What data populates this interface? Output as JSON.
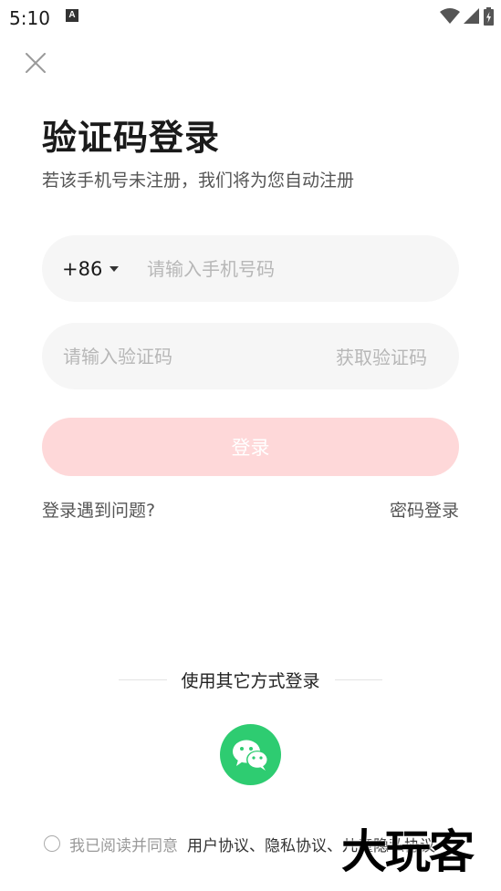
{
  "status_bar": {
    "time": "5:10",
    "notification_letter": "A"
  },
  "header": {
    "title": "验证码登录",
    "subtitle": "若该手机号未注册，我们将为您自动注册"
  },
  "phone_field": {
    "country_code": "+86",
    "placeholder": "请输入手机号码",
    "value": ""
  },
  "code_field": {
    "placeholder": "请输入验证码",
    "value": "",
    "get_code_label": "获取验证码"
  },
  "login_button": {
    "label": "登录"
  },
  "links": {
    "trouble": "登录遇到问题?",
    "password_login": "密码登录"
  },
  "other_login": {
    "label": "使用其它方式登录"
  },
  "agreement": {
    "prefix": "我已阅读并同意",
    "links": "用户协议、隐私协议、儿童隐私协议"
  },
  "watermark": "大玩客",
  "colors": {
    "login_button_disabled": "#fed8d9",
    "wechat": "#2ecc71",
    "field_bg": "#f6f6f6",
    "placeholder": "#b7b7b7"
  },
  "icons": {
    "close": "close-icon",
    "dropdown": "caret-down-icon",
    "wechat": "wechat-icon"
  }
}
